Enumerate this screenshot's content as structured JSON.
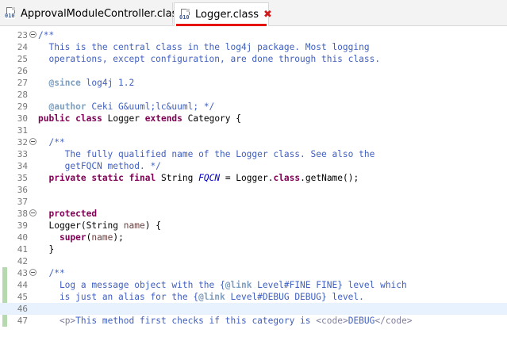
{
  "tabs": [
    {
      "label": "ApprovalModuleController.class",
      "active": false,
      "icon": "class-file-icon"
    },
    {
      "label": "Logger.class",
      "active": true,
      "icon": "class-file-icon",
      "close": "✖"
    }
  ],
  "editor": {
    "first_line": 23,
    "fold_lines": [
      23,
      32,
      38,
      43
    ],
    "current_line": 46,
    "change_marked_lines": [
      43,
      44,
      45,
      46,
      47
    ],
    "lines": [
      {
        "n": "23",
        "t": [
          [
            "/**",
            "cm"
          ]
        ]
      },
      {
        "n": "24",
        "t": [
          [
            "  This is the central class in the log4j package. Most logging",
            "cm"
          ]
        ]
      },
      {
        "n": "25",
        "t": [
          [
            "  operations, except configuration, are done through this class.",
            "cm"
          ]
        ]
      },
      {
        "n": "26",
        "t": []
      },
      {
        "n": "27",
        "t": [
          [
            "  ",
            ""
          ],
          [
            "@since",
            "tg"
          ],
          [
            " log4j 1.2",
            "cm"
          ]
        ]
      },
      {
        "n": "28",
        "t": []
      },
      {
        "n": "29",
        "t": [
          [
            "  ",
            ""
          ],
          [
            "@author",
            "tg"
          ],
          [
            " Ceki G&uuml;lc&uuml; */",
            "cm"
          ]
        ]
      },
      {
        "n": "30",
        "t": [
          [
            "public",
            "kw"
          ],
          [
            " ",
            ""
          ],
          [
            "class",
            "kw"
          ],
          [
            " Logger ",
            ""
          ],
          [
            "extends",
            "kw"
          ],
          [
            " Category {",
            ""
          ]
        ]
      },
      {
        "n": "31",
        "t": []
      },
      {
        "n": "32",
        "t": [
          [
            "  /**",
            "cm"
          ]
        ]
      },
      {
        "n": "33",
        "t": [
          [
            "     The fully qualified name of the Logger class. See also the",
            "cm"
          ]
        ]
      },
      {
        "n": "34",
        "t": [
          [
            "     getFQCN method. */",
            "cm"
          ]
        ]
      },
      {
        "n": "35",
        "t": [
          [
            "  ",
            ""
          ],
          [
            "private",
            "kw"
          ],
          [
            " ",
            ""
          ],
          [
            "static",
            "kw"
          ],
          [
            " ",
            ""
          ],
          [
            "final",
            "kw"
          ],
          [
            " String ",
            ""
          ],
          [
            "FQCN",
            "fi"
          ],
          [
            " = Logger.",
            ""
          ],
          [
            "class",
            "kw"
          ],
          [
            ".getName();",
            ""
          ]
        ]
      },
      {
        "n": "36",
        "t": []
      },
      {
        "n": "37",
        "t": []
      },
      {
        "n": "38",
        "t": [
          [
            "  ",
            ""
          ],
          [
            "protected",
            "kw"
          ]
        ]
      },
      {
        "n": "39",
        "t": [
          [
            "  Logger(String ",
            ""
          ],
          [
            "name",
            "pa"
          ],
          [
            ") {",
            ""
          ]
        ]
      },
      {
        "n": "40",
        "t": [
          [
            "    ",
            ""
          ],
          [
            "super",
            "kw"
          ],
          [
            "(",
            ""
          ],
          [
            "name",
            "pa"
          ],
          [
            ");",
            ""
          ]
        ]
      },
      {
        "n": "41",
        "t": [
          [
            "  }",
            ""
          ]
        ]
      },
      {
        "n": "42",
        "t": []
      },
      {
        "n": "43",
        "t": [
          [
            "  /**",
            "cm"
          ]
        ]
      },
      {
        "n": "44",
        "t": [
          [
            "    Log a message object with the {",
            "cm"
          ],
          [
            "@link",
            "tg"
          ],
          [
            " Level#FINE FINE} level which",
            "cm"
          ]
        ]
      },
      {
        "n": "45",
        "t": [
          [
            "    is just an alias for the {",
            "cm"
          ],
          [
            "@link",
            "tg"
          ],
          [
            " Level#DEBUG DEBUG} level.",
            "cm"
          ]
        ]
      },
      {
        "n": "46",
        "t": []
      },
      {
        "n": "47",
        "t": [
          [
            "    ",
            "cm"
          ],
          [
            "<p>",
            "ht"
          ],
          [
            "This method first checks if this category is ",
            "cm"
          ],
          [
            "<code>",
            "ht"
          ],
          [
            "DEBUG",
            "cm"
          ],
          [
            "</code>",
            "ht"
          ]
        ]
      }
    ]
  },
  "colors": {
    "comment": "#3f5fbf",
    "javadoc_tag": "#7f9fbf",
    "keyword": "#7f0055",
    "field": "#0000c0",
    "parameter": "#6a3e3e",
    "html_tag": "#7f7f9f",
    "current_line": "#e8f2fe",
    "active_tab_underline": "#e51400"
  }
}
